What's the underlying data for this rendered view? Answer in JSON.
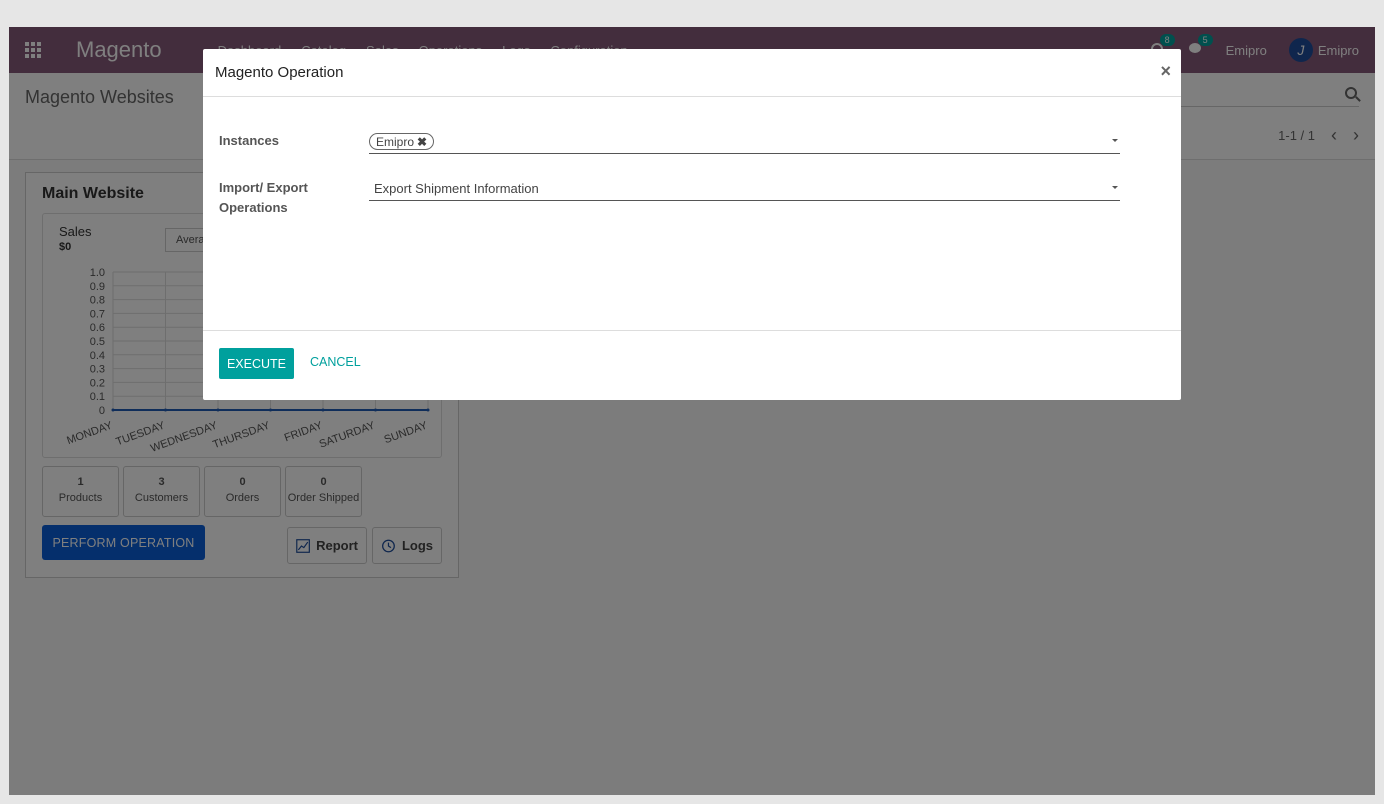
{
  "navbar": {
    "brand": "Magento",
    "menu": [
      "Dashboard",
      "Catalog",
      "Sales",
      "Operations",
      "Logs",
      "Configuration"
    ],
    "activity_count": "8",
    "message_count": "5",
    "company": "Emipro",
    "user": "Emipro"
  },
  "control_panel": {
    "breadcrumb": "Magento Websites",
    "pager": "1-1 / 1"
  },
  "dashboard_card": {
    "title": "Main Website",
    "graph": {
      "title": "Sales",
      "total": "$0",
      "period": "Average"
    },
    "stats": [
      {
        "value": "1",
        "label": "Products"
      },
      {
        "value": "3",
        "label": "Customers"
      },
      {
        "value": "0",
        "label": "Orders"
      },
      {
        "value": "0",
        "label": "Order Shipped"
      }
    ],
    "perform_label": "PERFORM OPERATION",
    "report_label": "Report",
    "logs_label": "Logs"
  },
  "chart_data": {
    "type": "line",
    "title": "Sales",
    "categories": [
      "MONDAY",
      "TUESDAY",
      "WEDNESDAY",
      "THURSDAY",
      "FRIDAY",
      "SATURDAY",
      "SUNDAY"
    ],
    "series": [
      {
        "values": [
          0,
          0,
          0,
          0,
          0,
          0,
          0
        ]
      }
    ],
    "yticks": [
      "0",
      "0.1",
      "0.2",
      "0.3",
      "0.4",
      "0.5",
      "0.6",
      "0.7",
      "0.8",
      "0.9",
      "1.0"
    ],
    "ylim": [
      0,
      1
    ],
    "grid": true,
    "colors": {
      "line": "#1f5bb5",
      "grid": "#dddddd"
    }
  },
  "modal": {
    "title": "Magento Operation",
    "instances_label": "Instances",
    "instance_tag": "Emipro",
    "operations_label_line1": "Import/ Export",
    "operations_label_line2": "Operations",
    "operation_value": "Export Shipment Information",
    "execute_label": "EXECUTE",
    "cancel_label": "CANCEL"
  },
  "colors": {
    "navbar": "#875a7b",
    "primary": "#00a09d",
    "perform_button": "#0a5fd8"
  }
}
